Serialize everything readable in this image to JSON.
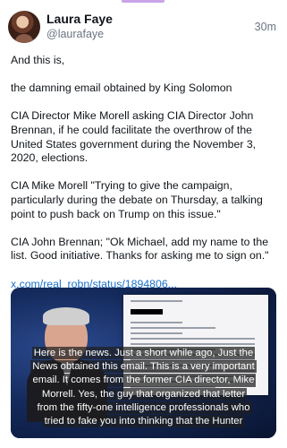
{
  "post": {
    "author_name": "Laura Faye",
    "author_handle": "@laurafaye",
    "time": "30m",
    "paragraphs": [
      "And this is,",
      "the damning email obtained by King Solomon",
      "CIA Director Mike Morell asking CIA Director John Brennan, if he could facilitate the overthrow of the United States government during the November 3, 2020, elections.",
      "CIA Mike Morell \"Trying to give the campaign, particularly during the debate on Thursday, a talking point to push back on Trump on this issue.\"",
      "CIA John Brennan; \"Ok Michael, add my name to the list. Good initiative. Thanks for asking me to sign on.\""
    ],
    "link": "x.com/real_robn/status/1894806..."
  },
  "video": {
    "caption_lines": [
      "Here is the news. Just a short while ago, Just the",
      "News obtained this email. This is a very important",
      "email. It comes from the former CIA director, Mike",
      "Morrell. Yes, the guy that organized that letter",
      "from the fifty-one intelligence professionals who",
      "tried to fake you into thinking that the Hunter"
    ]
  },
  "icons": {
    "avatar": "profile-photo"
  }
}
